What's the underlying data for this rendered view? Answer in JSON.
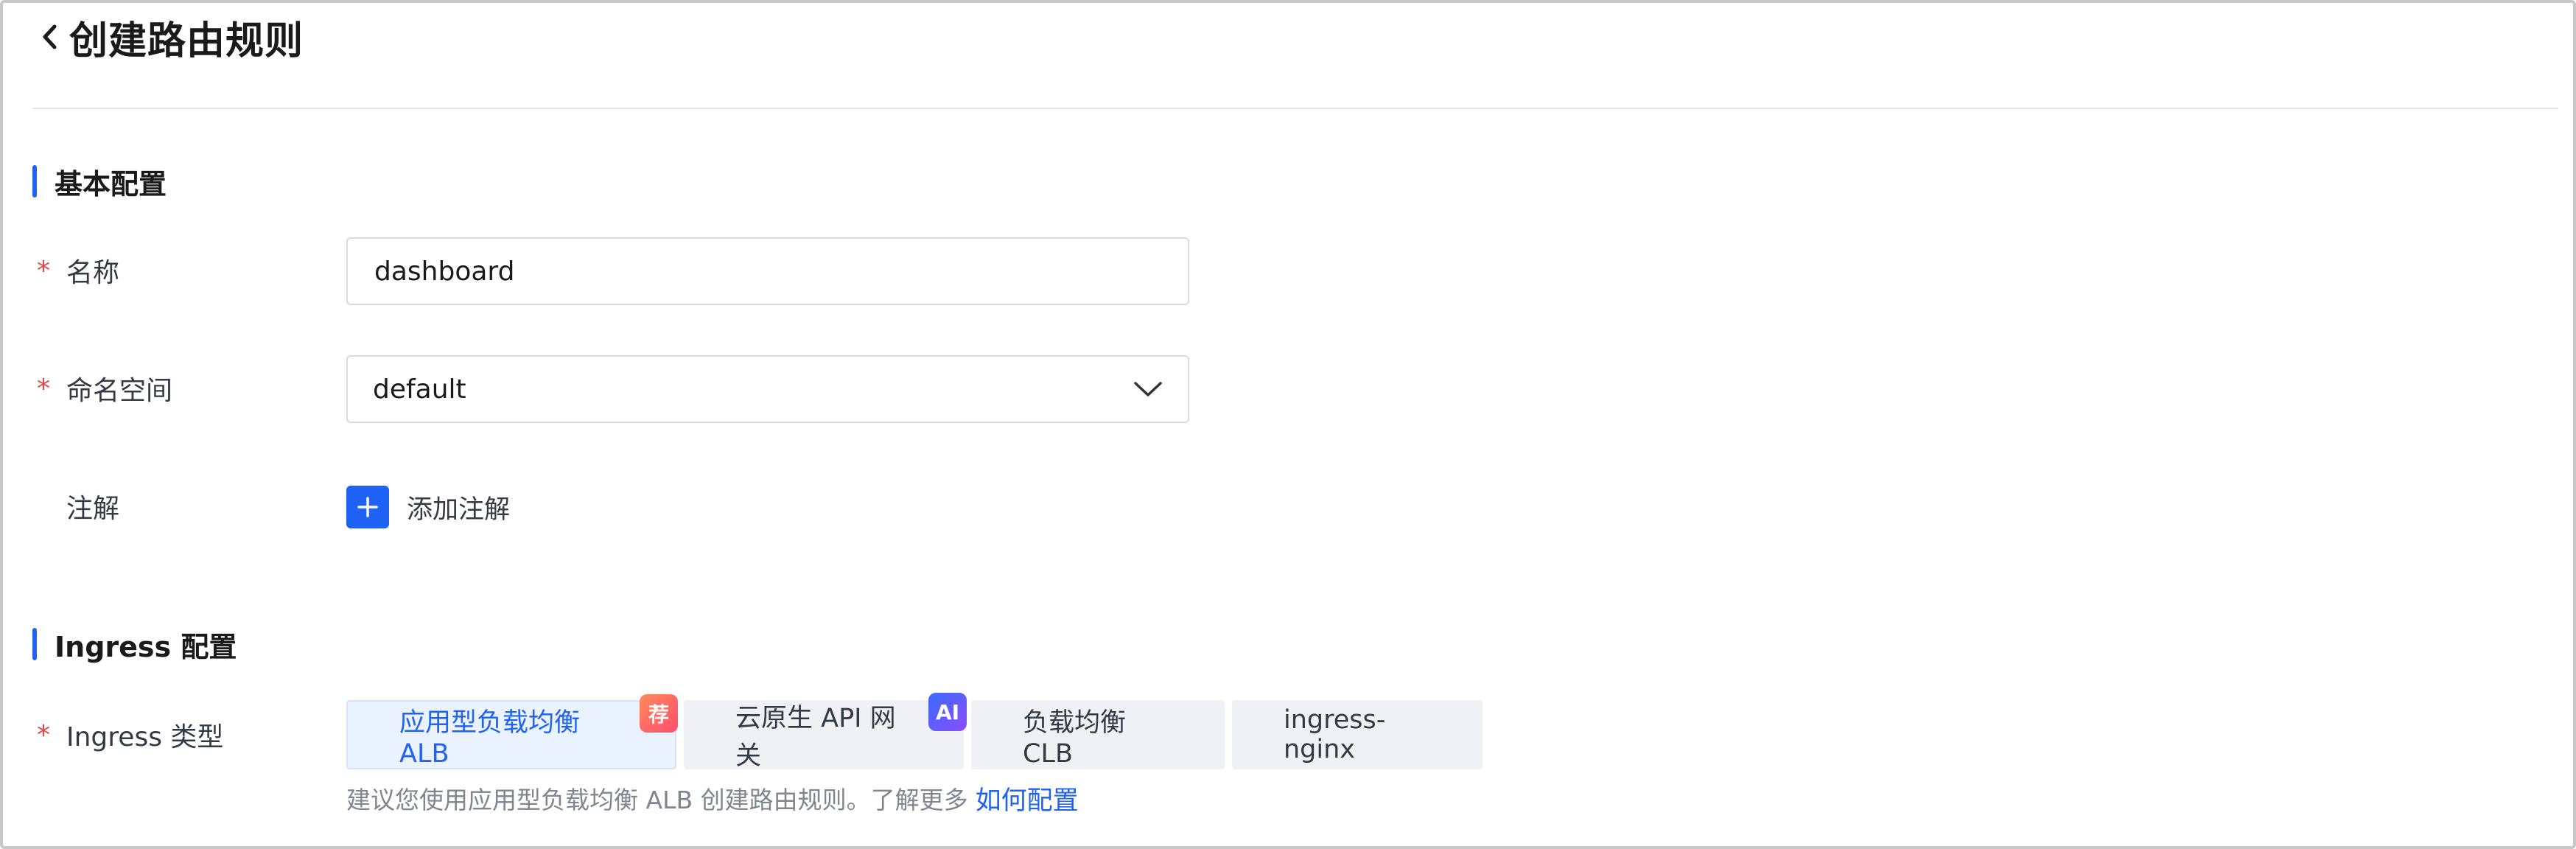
{
  "header": {
    "title": "创建路由规则"
  },
  "sections": {
    "basic": {
      "title": "基本配置"
    },
    "ingress": {
      "title": "Ingress 配置"
    }
  },
  "form": {
    "name": {
      "label": "名称",
      "required_mark": "*",
      "value": "dashboard"
    },
    "namespace": {
      "label": "命名空间",
      "required_mark": "*",
      "value": "default"
    },
    "annotation": {
      "label": "注解",
      "add_label": "添加注解"
    },
    "ingress_type": {
      "label": "Ingress 类型",
      "required_mark": "*",
      "options": [
        {
          "label": "应用型负载均衡 ALB",
          "selected": true,
          "badge": "荐"
        },
        {
          "label": "云原生 API 网关",
          "selected": false,
          "badge": "AI"
        },
        {
          "label": "负载均衡 CLB",
          "selected": false
        },
        {
          "label": "ingress-nginx",
          "selected": false
        }
      ],
      "hint": "建议您使用应用型负载均衡 ALB 创建路由规则。了解更多",
      "hint_link": "如何配置"
    }
  },
  "colors": {
    "accent": "#1e63f5",
    "required": "#e54545",
    "selected_bg": "#eaf1ff",
    "tab_bg": "#f0f1f4"
  }
}
